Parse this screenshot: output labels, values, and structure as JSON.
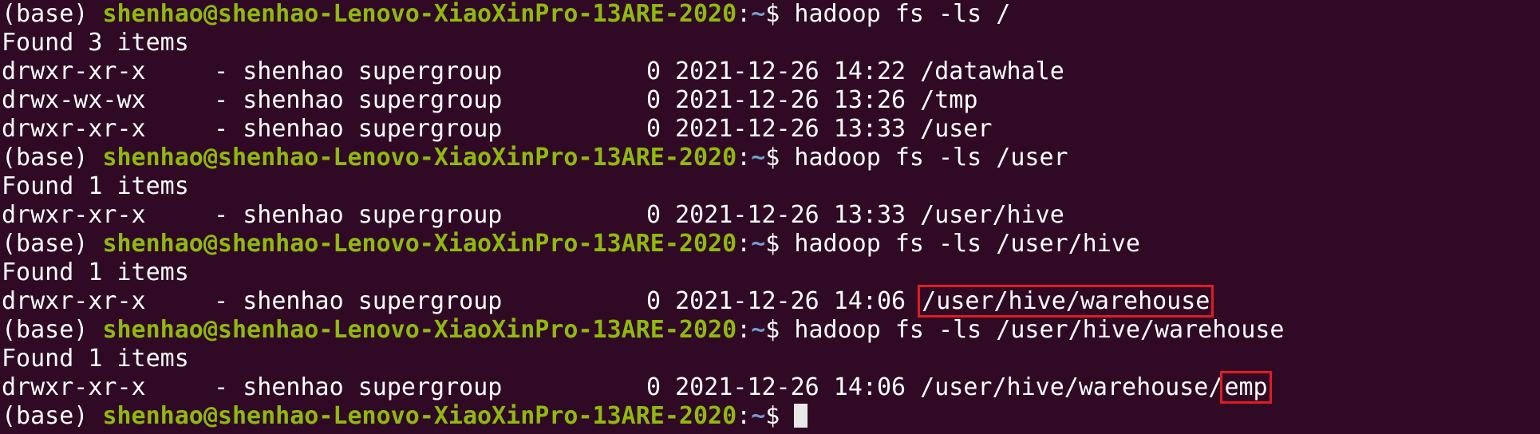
{
  "prompt": {
    "env": "(base) ",
    "user_host": "shenhao@shenhao-Lenovo-XiaoXinPro-13ARE-2020",
    "colon": ":",
    "path": "~",
    "dollar": "$ "
  },
  "lines": [
    {
      "type": "cmd",
      "command": "hadoop fs -ls /"
    },
    {
      "type": "out",
      "text": "Found 3 items"
    },
    {
      "type": "entry",
      "perms": "drwxr-xr-x",
      "meta": "  - shenhao supergroup          0 2021-12-26 14:22 ",
      "path": "/datawhale"
    },
    {
      "type": "entry",
      "perms": "drwx-wx-wx",
      "meta": "  - shenhao supergroup          0 2021-12-26 13:26 ",
      "path": "/tmp"
    },
    {
      "type": "entry",
      "perms": "drwxr-xr-x",
      "meta": "  - shenhao supergroup          0 2021-12-26 13:33 ",
      "path": "/user"
    },
    {
      "type": "cmd",
      "command": "hadoop fs -ls /user"
    },
    {
      "type": "out",
      "text": "Found 1 items"
    },
    {
      "type": "entry",
      "perms": "drwxr-xr-x",
      "meta": "  - shenhao supergroup          0 2021-12-26 13:33 ",
      "path": "/user/hive"
    },
    {
      "type": "cmd",
      "command": "hadoop fs -ls /user/hive"
    },
    {
      "type": "out",
      "text": "Found 1 items"
    },
    {
      "type": "entry",
      "perms": "drwxr-xr-x",
      "meta": "  - shenhao supergroup          0 2021-12-26 14:06 ",
      "path": "",
      "boxed": "/user/hive/warehouse"
    },
    {
      "type": "cmd",
      "command": "hadoop fs -ls /user/hive/warehouse"
    },
    {
      "type": "out",
      "text": "Found 1 items"
    },
    {
      "type": "entry",
      "perms": "drwxr-xr-x",
      "meta": "  - shenhao supergroup          0 2021-12-26 14:06 ",
      "path": "/user/hive/warehouse/",
      "boxed": "emp"
    },
    {
      "type": "prompt"
    }
  ],
  "colors": {
    "background": "#300a24",
    "user_host": "#8fb90d",
    "path": "#729fcf",
    "highlight_box": "#e01b24"
  }
}
